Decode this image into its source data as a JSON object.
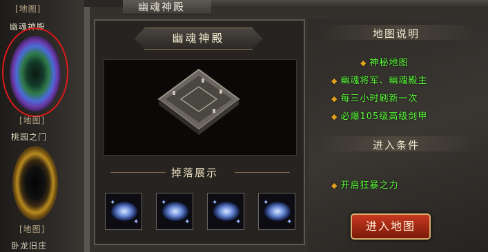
{
  "window": {
    "title": "幽魂神殿"
  },
  "map_list": [
    {
      "tag": "[地图]",
      "name": "幽魂神殿",
      "selected": true
    },
    {
      "tag": "[地图]",
      "name": "桃园之门",
      "selected": false
    },
    {
      "tag": "[地图]",
      "name": "卧龙旧庄",
      "selected": false
    }
  ],
  "map_detail": {
    "name": "幽魂神殿",
    "drops_title": "掉落展示",
    "drops": [
      {
        "icon": "blue-sparkle-ring-icon"
      },
      {
        "icon": "blue-sparkle-ring-icon"
      },
      {
        "icon": "helmet-icon"
      },
      {
        "icon": "blue-sparkle-ring-icon"
      }
    ]
  },
  "description": {
    "title": "地图说明",
    "lines": [
      "神秘地图",
      "幽魂将军、幽魂殿主",
      "每三小时刷新一次",
      "必爆105级高级剑甲"
    ]
  },
  "requirements": {
    "title": "进入条件",
    "lines": [
      "开启狂暴之力"
    ]
  },
  "enter_button": {
    "label": "进入地图"
  },
  "colors": {
    "info_text": "#5cff3a",
    "bullet": "#e0a020",
    "selection_ring": "#e01818",
    "button_red": "#c83820"
  }
}
